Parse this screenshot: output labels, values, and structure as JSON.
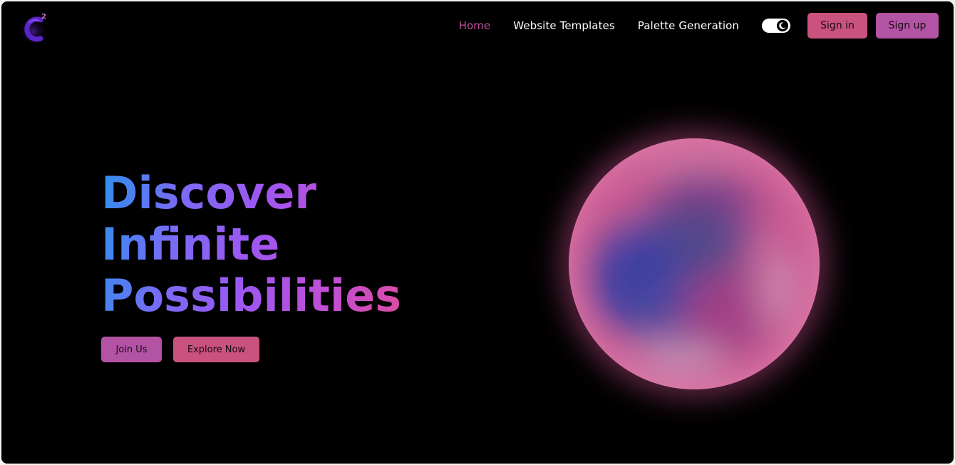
{
  "nav": {
    "logo_icon": "c-squared-logo-icon",
    "links": [
      {
        "label": "Home",
        "active": true
      },
      {
        "label": "Website Templates",
        "active": false
      },
      {
        "label": "Palette Generation",
        "active": false
      }
    ],
    "theme_toggle_icon": "moon-icon",
    "sign_in_label": "Sign in",
    "sign_up_label": "Sign up"
  },
  "hero": {
    "title_lines": [
      "Discover",
      "Infinite",
      "Possibilities"
    ],
    "join_label": "Join Us",
    "explore_label": "Explore Now"
  },
  "colors": {
    "background": "#000000",
    "accent_pink": "#c9527e",
    "accent_purple": "#b353a3",
    "active_link": "#c14f9e",
    "gradient_start": "#2f8fee",
    "gradient_end": "#e24b9b"
  }
}
